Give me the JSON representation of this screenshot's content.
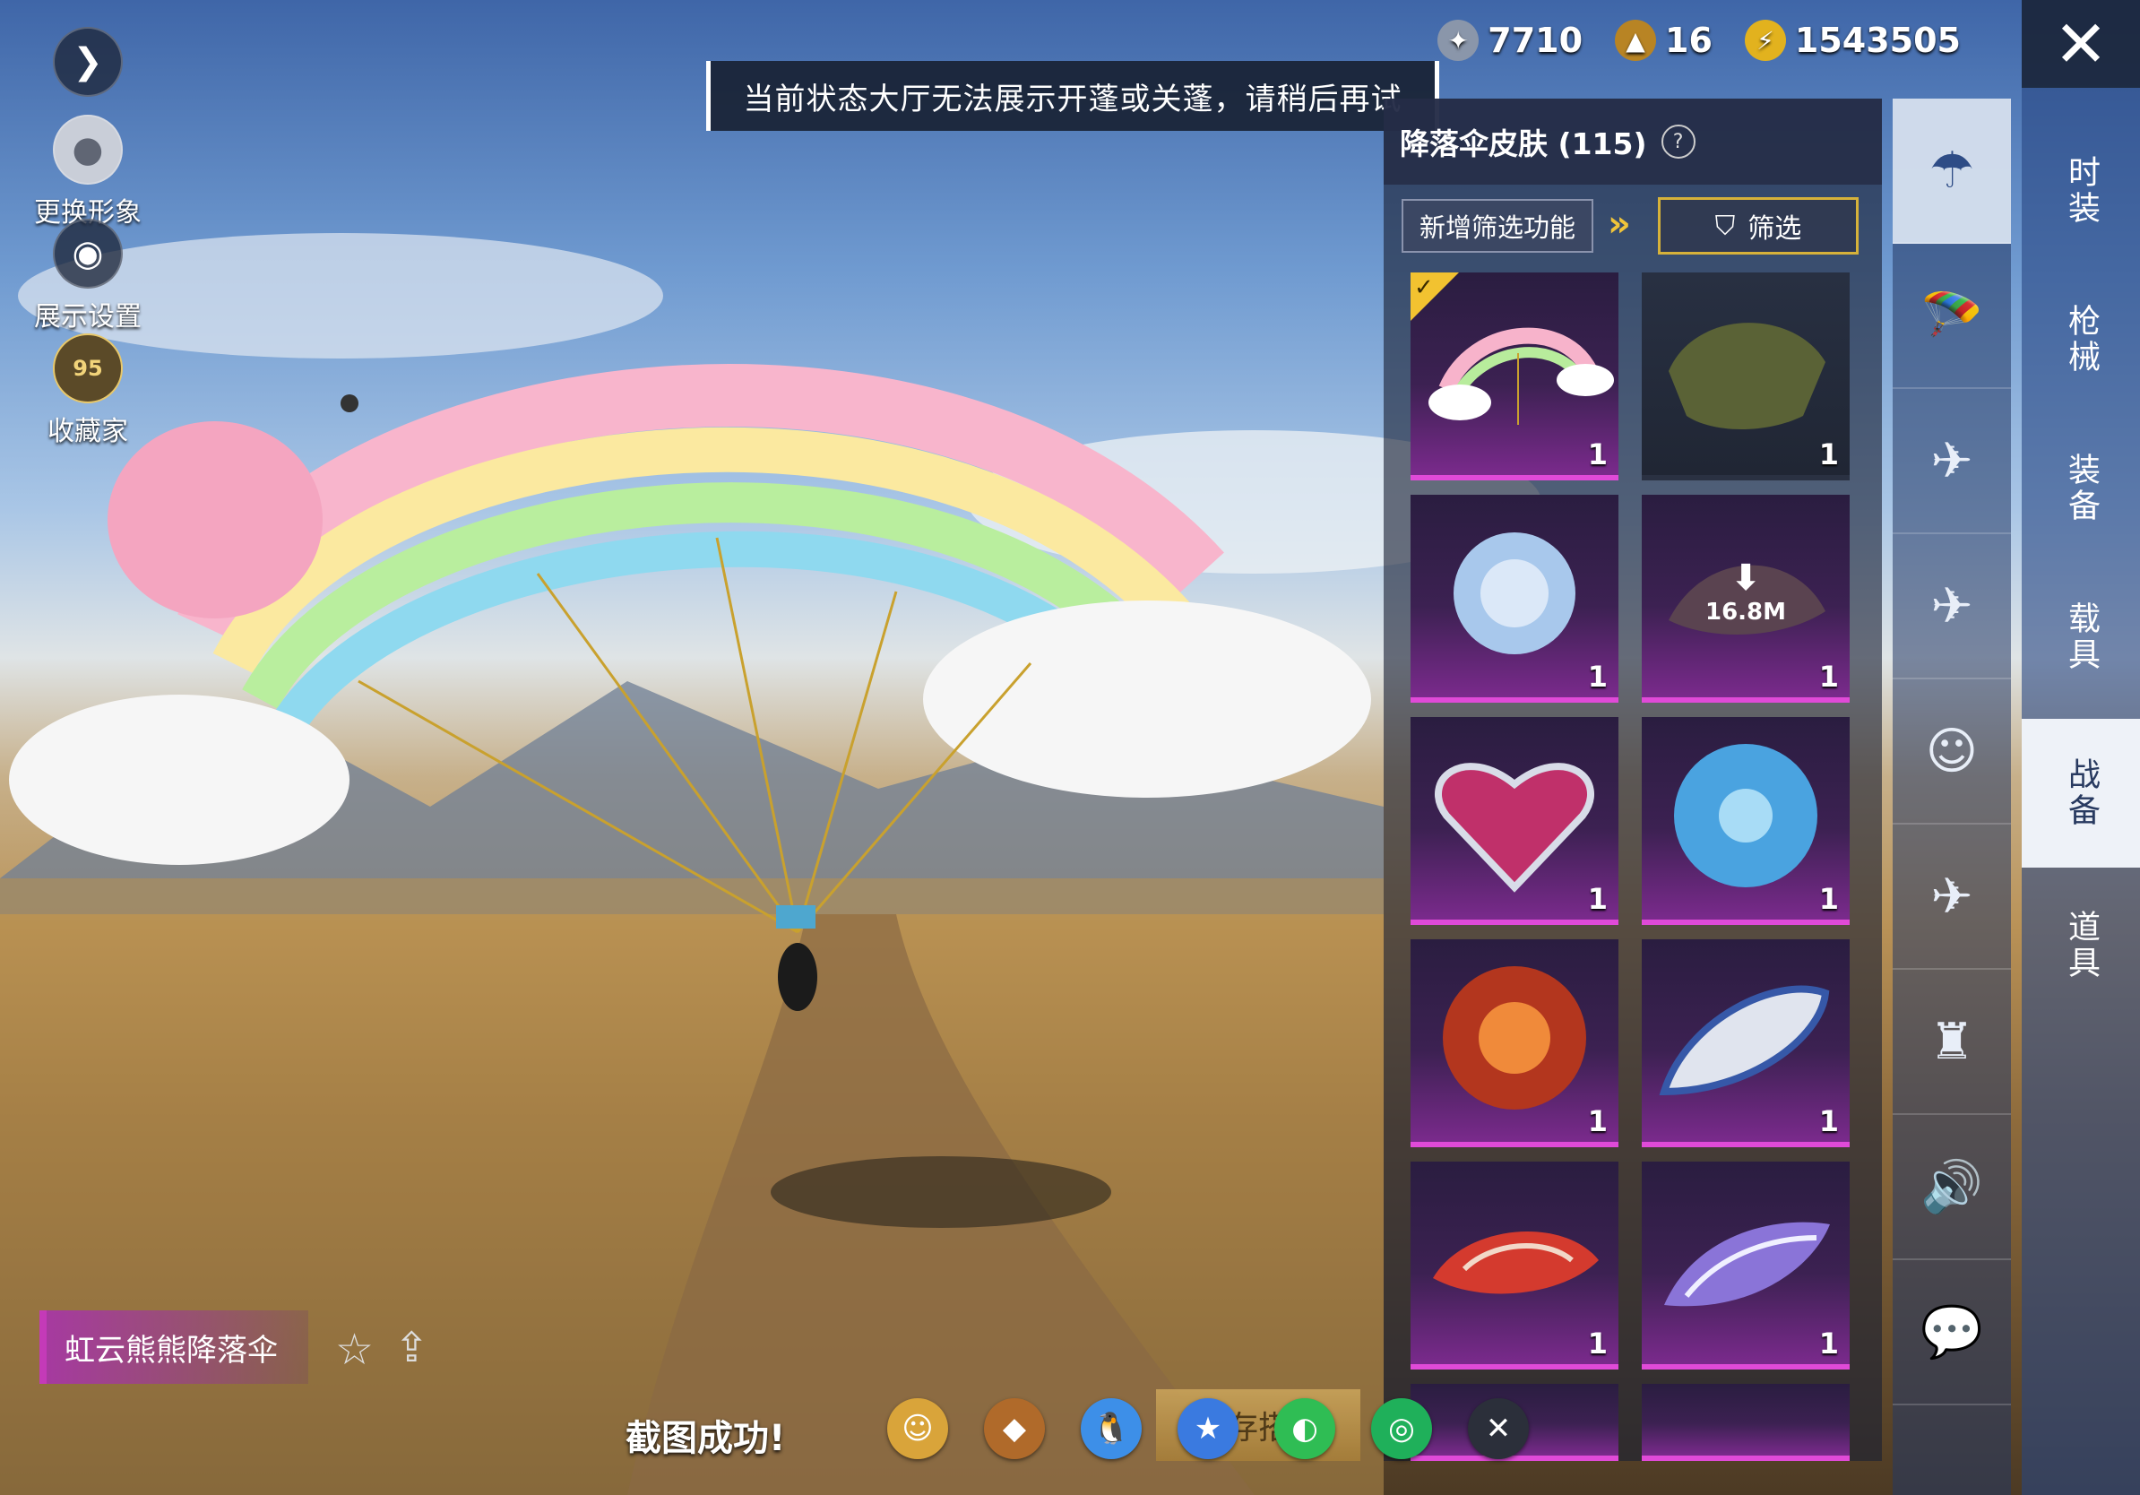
{
  "left_menu": {
    "expand_icon": "chevron-right-icon",
    "items": [
      {
        "label": "更换形象",
        "icon": "avatar-icon"
      },
      {
        "label": "展示设置",
        "icon": "eye-icon"
      },
      {
        "label": "收藏家",
        "icon": "collector-badge-icon",
        "badge_value": "95"
      }
    ]
  },
  "toast": {
    "text": "当前状态大厅无法展示开蓬或关蓬，请稍后再试"
  },
  "currencies": [
    {
      "icon": "silver-coin-icon",
      "value": "7710",
      "color": "#9aa6b8"
    },
    {
      "icon": "gold-emblem-icon",
      "value": "16",
      "color": "#c9962a"
    },
    {
      "icon": "lightning-coin-icon",
      "value": "1543505",
      "color": "#e7b820"
    }
  ],
  "close_icon": "close-icon",
  "panel": {
    "title": "降落伞皮肤 (115)",
    "help_icon": "question-icon",
    "new_filter_label": "新增筛选功能",
    "filter_label": "筛选",
    "items": [
      {
        "qty": "1",
        "equipped": true,
        "name": "rainbow-bear-parachute"
      },
      {
        "qty": "1",
        "name": "military-green-parachute"
      },
      {
        "qty": "1",
        "name": "crystal-flower-parachute"
      },
      {
        "qty": "1",
        "download_size": "16.8M",
        "name": "download-pending-parachute"
      },
      {
        "qty": "1",
        "name": "heart-parachute"
      },
      {
        "qty": "1",
        "name": "ice-orb-parachute"
      },
      {
        "qty": "1",
        "name": "fire-orb-parachute"
      },
      {
        "qty": "1",
        "name": "blue-white-parachute"
      },
      {
        "qty": "1",
        "name": "red-flame-parachute"
      },
      {
        "qty": "1",
        "name": "purple-wing-parachute"
      }
    ]
  },
  "categories": [
    {
      "icon": "parachute-icon",
      "selected": true
    },
    {
      "icon": "skydiver-icon"
    },
    {
      "icon": "drone-icon"
    },
    {
      "icon": "airplane-icon"
    },
    {
      "icon": "emote-face-icon"
    },
    {
      "icon": "glider-icon"
    },
    {
      "icon": "robot-icon"
    },
    {
      "icon": "speaker-icon"
    },
    {
      "icon": "chat-bubble-icon"
    }
  ],
  "tabs": [
    {
      "label": "时装"
    },
    {
      "label": "枪械"
    },
    {
      "label": "装备"
    },
    {
      "label": "载具"
    },
    {
      "label": "战备",
      "selected": true
    },
    {
      "label": "道具"
    }
  ],
  "bottom": {
    "item_name": "虹云熊熊降落伞",
    "favorite_icon": "star-icon",
    "share_icon": "share-icon",
    "screenshot_text": "截图成功!",
    "save_label": "存搭",
    "share_targets": [
      {
        "icon": "profile-icon",
        "color": "#d9a43a"
      },
      {
        "icon": "game-logo-icon",
        "color": "#b06a2a"
      },
      {
        "icon": "qq-icon",
        "color": "#3d8fe8"
      },
      {
        "icon": "qzone-icon",
        "color": "#3a7ae0"
      },
      {
        "icon": "wechat-icon",
        "color": "#2fbd54"
      },
      {
        "icon": "moments-icon",
        "color": "#1fb05a"
      },
      {
        "icon": "close-icon",
        "color": "#2b2f3a"
      }
    ]
  }
}
